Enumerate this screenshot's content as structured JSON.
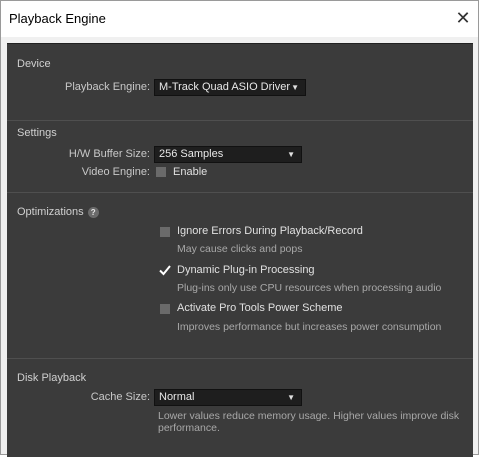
{
  "window": {
    "title": "Playback Engine",
    "close_glyph": "✕"
  },
  "device": {
    "header": "Device",
    "playback_engine_label": "Playback Engine:",
    "playback_engine_value": "M-Track Quad ASIO Driver"
  },
  "settings": {
    "header": "Settings",
    "buffer_label": "H/W Buffer Size:",
    "buffer_value": "256 Samples",
    "video_engine_label": "Video Engine:",
    "video_engine_option": "Enable",
    "video_engine_checked": false
  },
  "optimizations": {
    "header": "Optimizations",
    "help_glyph": "?",
    "items": [
      {
        "label": "Ignore Errors During Playback/Record",
        "description": "May cause clicks and pops",
        "checked": false
      },
      {
        "label": "Dynamic Plug-in Processing",
        "description": "Plug-ins only use CPU resources when processing audio",
        "checked": true
      },
      {
        "label": "Activate Pro Tools Power Scheme",
        "description": "Improves performance but increases power consumption",
        "checked": false
      }
    ]
  },
  "disk_playback": {
    "header": "Disk Playback",
    "cache_label": "Cache Size:",
    "cache_value": "Normal",
    "note_line1": "Lower values reduce memory usage. Higher values improve disk",
    "note_line2": "performance."
  },
  "colors": {
    "panel_bg": "#3b3b3b",
    "dropdown_bg": "#1e1e1e",
    "checkmark": "#ffffff"
  },
  "icons": {
    "close": "close-icon",
    "help": "help-icon",
    "caret": "chevron-down-icon",
    "check": "checkmark-icon"
  }
}
